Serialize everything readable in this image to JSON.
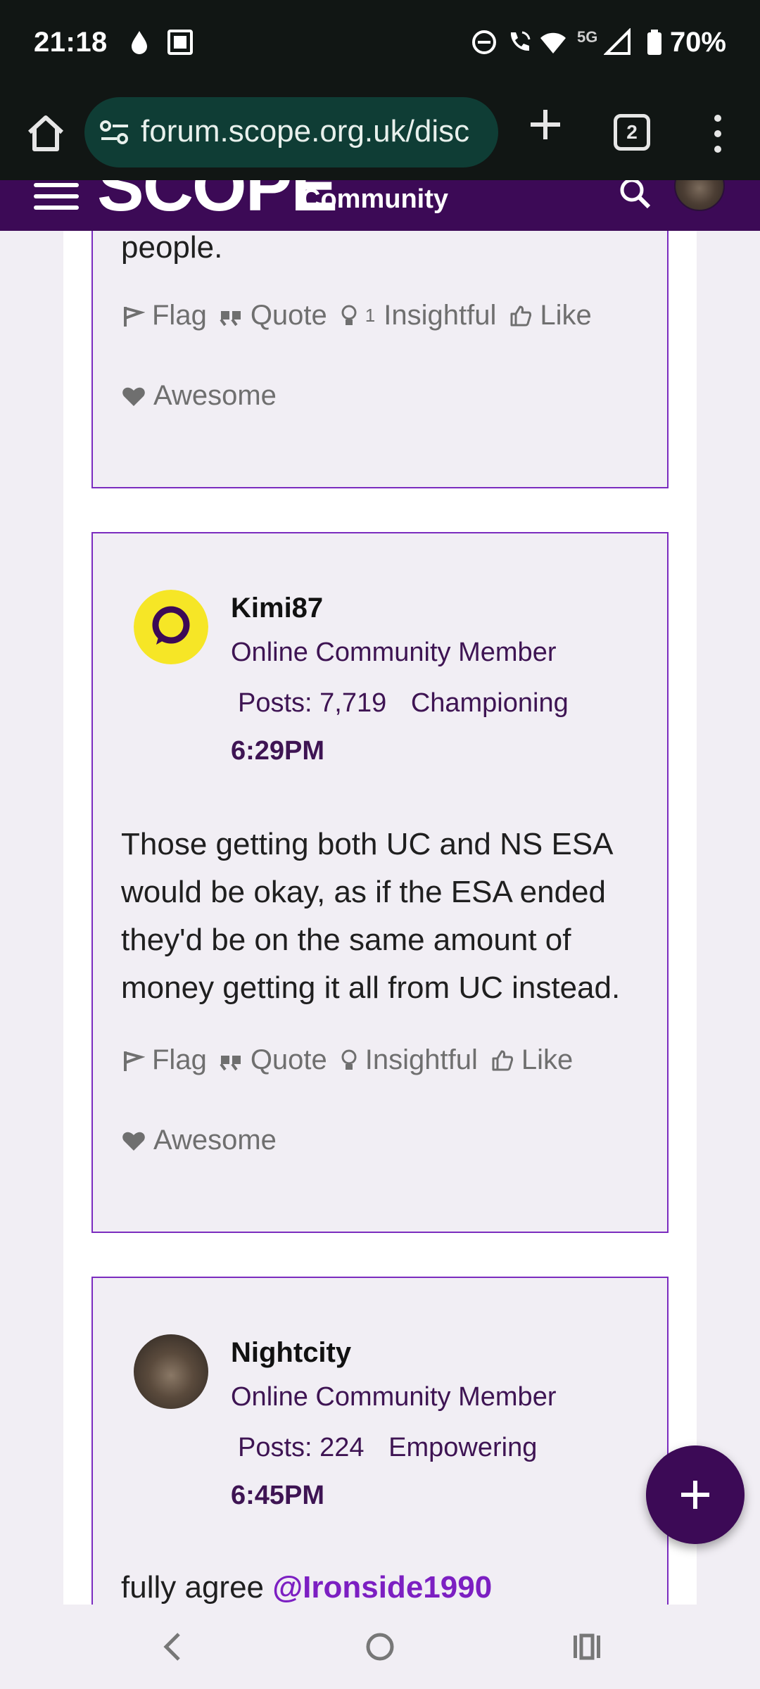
{
  "status_bar": {
    "time": "21:18",
    "network": "5G",
    "battery": "70%"
  },
  "browser": {
    "url": "forum.scope.org.uk/disc",
    "tab_count": "2"
  },
  "site_header": {
    "logo": "SCOPE",
    "subtitle": "Community"
  },
  "posts": [
    {
      "body_fragment": "people.",
      "actions": {
        "flag": "Flag",
        "quote": "Quote",
        "insightful_count": "1",
        "insightful": "Insightful",
        "like": "Like",
        "awesome": "Awesome"
      }
    },
    {
      "author": "Kimi87",
      "role": "Online Community Member",
      "posts_label": "Posts: 7,719",
      "rank": "Championing",
      "time": "6:29PM",
      "body": "Those getting both UC and NS ESA would be okay, as if the ESA ended they'd be on the same amount of money getting it all from UC instead.",
      "actions": {
        "flag": "Flag",
        "quote": "Quote",
        "insightful": "Insightful",
        "like": "Like",
        "awesome": "Awesome"
      }
    },
    {
      "author": "Nightcity",
      "role": "Online Community Member",
      "posts_label": "Posts: 224",
      "rank": "Empowering",
      "time": "6:45PM",
      "body_prefix": "fully agree ",
      "mention": "@Ironside1990"
    }
  ],
  "colors": {
    "brand_purple": "#3c0a56",
    "card_border": "#7b2cbf",
    "mention": "#7c1fc2",
    "page_bg": "#f1eef4"
  }
}
